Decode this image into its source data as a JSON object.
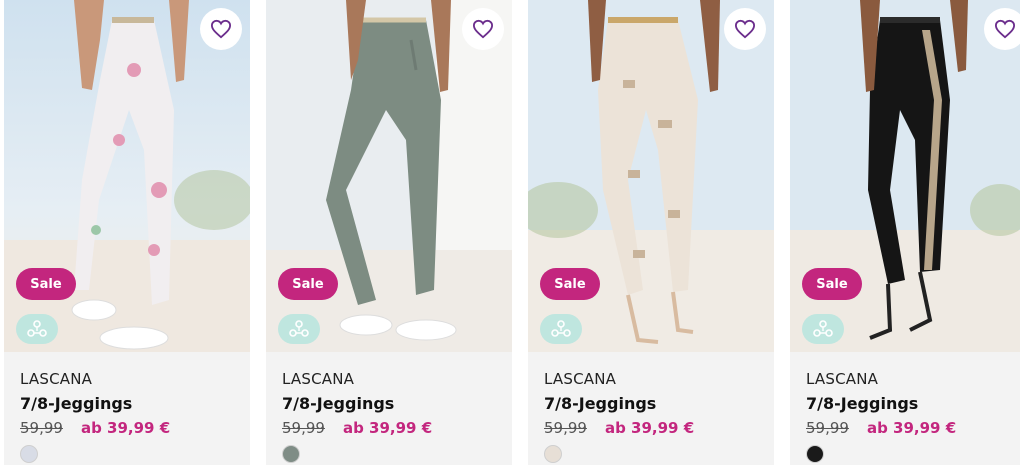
{
  "colors": {
    "accent": "#c3267e",
    "sale_bg": "#c3267e",
    "sustain_bg": "#bfe6df",
    "price_new": "#c3267e"
  },
  "products": [
    {
      "brand": "LASCANA",
      "title": "7/8-Jeggings",
      "old_price": "59,99",
      "new_price": "ab 39,99 €",
      "sale_label": "Sale",
      "swatch_color": "#d8dce6",
      "pants_color": "#f1eef0",
      "accent_color": "#e39bb6"
    },
    {
      "brand": "LASCANA",
      "title": "7/8-Jeggings",
      "old_price": "59,99",
      "new_price": "ab 39,99 €",
      "sale_label": "Sale",
      "swatch_color": "#7f8d86",
      "pants_color": "#7d8c82",
      "accent_color": "#6e7b73"
    },
    {
      "brand": "LASCANA",
      "title": "7/8-Jeggings",
      "old_price": "59,99",
      "new_price": "ab 39,99 €",
      "sale_label": "Sale",
      "swatch_color": "#e7dfd6",
      "pants_color": "#ece3d8",
      "accent_color": "#c8b39a"
    },
    {
      "brand": "LASCANA",
      "title": "7/8-Jeggings",
      "old_price": "59,99",
      "new_price": "ab 39,99 €",
      "sale_label": "Sale",
      "swatch_color": "#1a1a1a",
      "pants_color": "#151515",
      "accent_color": "#b7a58a"
    }
  ]
}
